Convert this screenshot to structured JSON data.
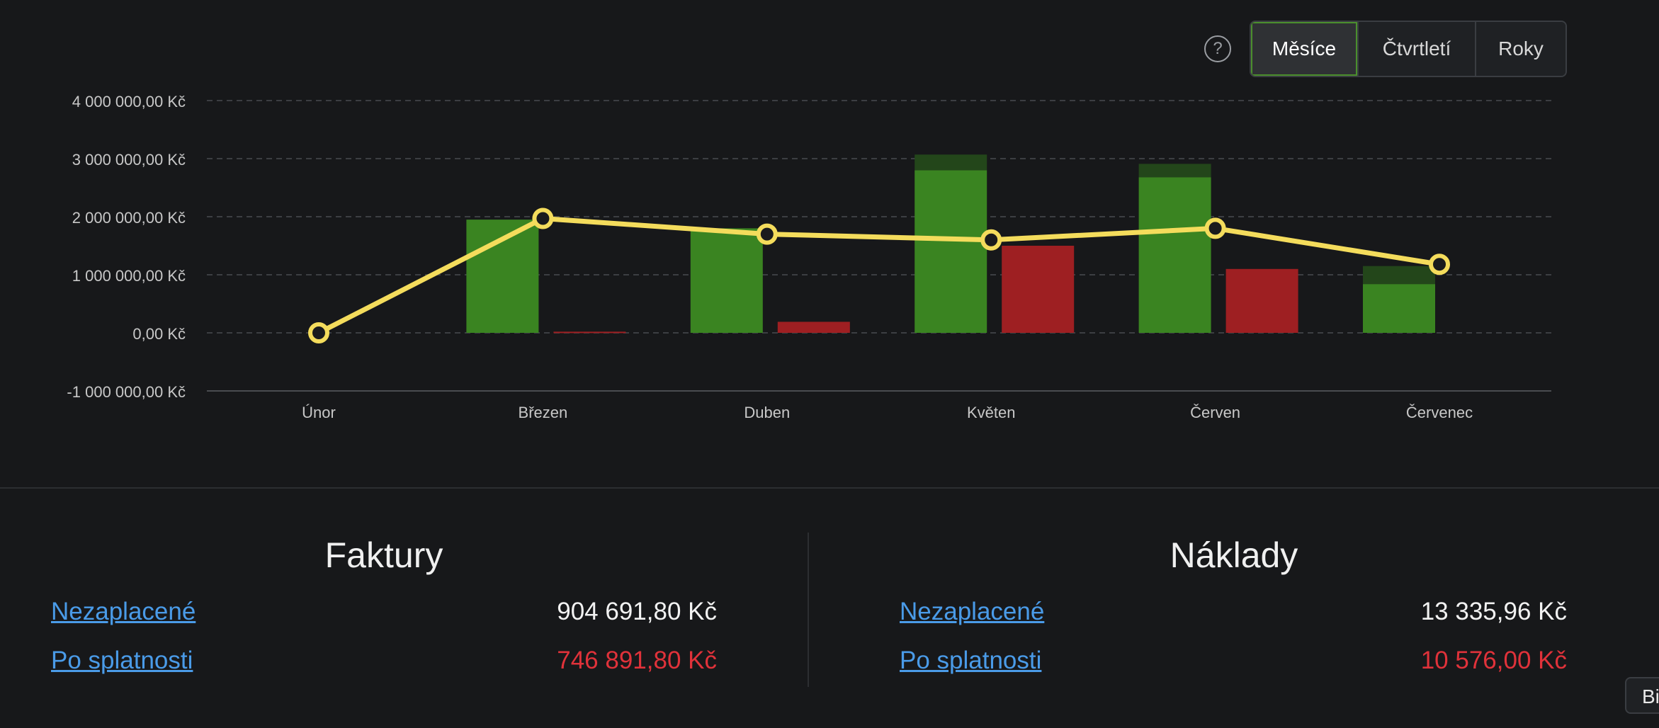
{
  "toolbar": {
    "help_label": "?",
    "period_options": [
      "Měsíce",
      "Čtvrtletí",
      "Roky"
    ],
    "active_period": "Měsíce"
  },
  "chart_data": {
    "type": "bar",
    "categories": [
      "Únor",
      "Březen",
      "Duben",
      "Květen",
      "Červen",
      "Červenec"
    ],
    "ylim": [
      -1000000,
      4000000
    ],
    "y_ticks": [
      "4 000 000,00 Kč",
      "3 000 000,00 Kč",
      "2 000 000,00 Kč",
      "1 000 000,00 Kč",
      "0,00 Kč",
      "-1 000 000,00 Kč"
    ],
    "y_tick_values": [
      4000000,
      3000000,
      2000000,
      1000000,
      0,
      -1000000
    ],
    "grid": true,
    "series": [
      {
        "values": [
          0,
          1950000,
          1800000,
          2800000,
          2680000,
          840000
        ],
        "color": "#3a8421"
      },
      {
        "values": [
          0,
          0,
          0,
          270000,
          230000,
          310000
        ],
        "color": "#23461a"
      },
      {
        "values": [
          0,
          20000,
          190000,
          1500000,
          1100000,
          0
        ],
        "color": "#9e1f22"
      },
      {
        "values": [
          0,
          1970000,
          1700000,
          1600000,
          1800000,
          1180000
        ],
        "color": "#f4dc5c",
        "type": "line"
      }
    ]
  },
  "summary": {
    "invoices": {
      "title": "Faktury",
      "unpaid_label": "Nezaplacené",
      "unpaid_value": "904 691,80 Kč",
      "overdue_label": "Po splatnosti",
      "overdue_value": "746 891,80 Kč"
    },
    "costs": {
      "title": "Náklady",
      "unpaid_label": "Nezaplacené",
      "unpaid_value": "13 335,96 Kč",
      "overdue_label": "Po splatnosti",
      "overdue_value": "10 576,00 Kč"
    }
  },
  "corner_tab_label": "Bi",
  "colors": {
    "background": "#17181a",
    "link": "#4a9be8",
    "overdue": "#e0323a",
    "bar_green": "#3a8421",
    "bar_dark_green": "#23461a",
    "bar_red": "#9e1f22",
    "line_yellow": "#f4dc5c"
  }
}
